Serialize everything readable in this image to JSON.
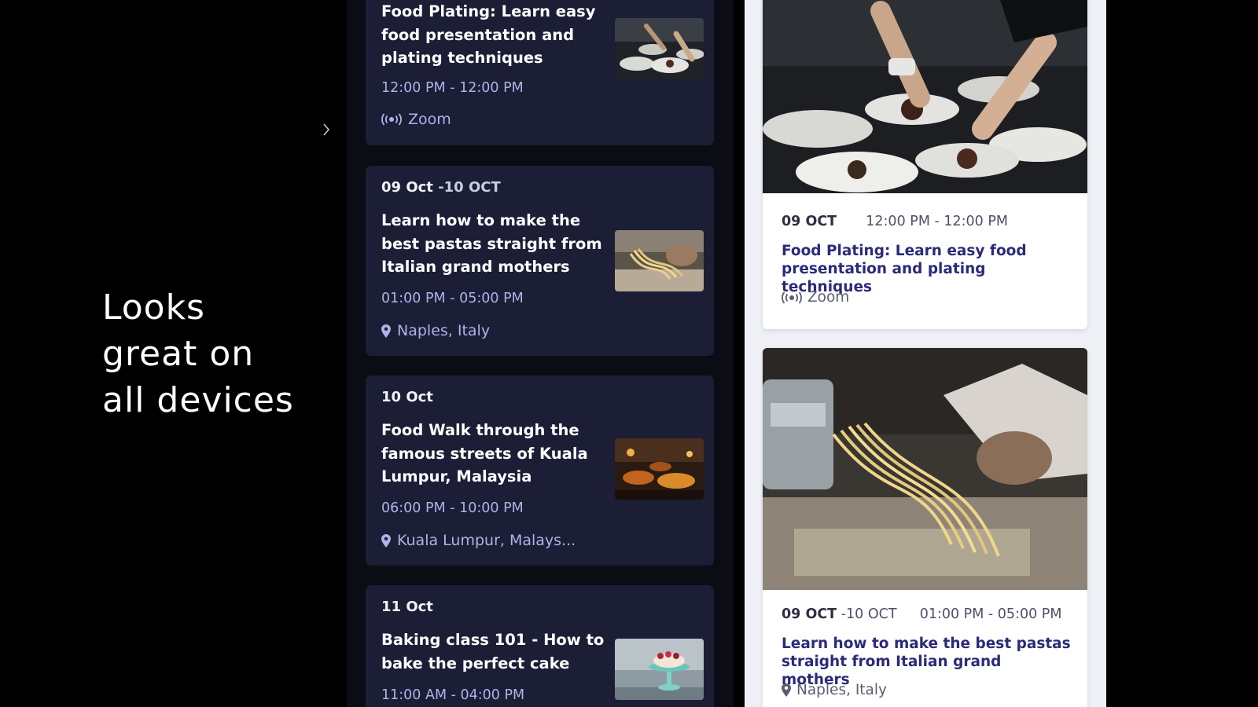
{
  "tagline": [
    "Looks",
    "great on",
    "all devices"
  ],
  "dark_phone": {
    "cards": [
      {
        "title": "Food Plating: Learn easy food presentation and plating techniques",
        "time": "12:00 PM - 12:00 PM",
        "location": "Zoom",
        "location_icon": "broadcast-icon",
        "thumb": "plating"
      },
      {
        "date": "09 Oct",
        "date_end": "-10 OCT",
        "title": "Learn how to make the best pastas straight from Italian grand mothers",
        "time": "01:00 PM - 05:00 PM",
        "location": "Naples, Italy",
        "location_icon": "map-pin-icon",
        "thumb": "pasta"
      },
      {
        "date": "10 Oct",
        "title": "Food Walk through the famous streets of Kuala Lumpur, Malaysia",
        "time": "06:00 PM - 10:00 PM",
        "location": "Kuala Lumpur, Malays...",
        "location_icon": "map-pin-icon",
        "thumb": "street-food"
      },
      {
        "date": "11 Oct",
        "title": "Baking class 101 - How to bake the perfect cake",
        "time": "11:00 AM - 04:00 PM",
        "thumb": "cake"
      }
    ]
  },
  "light_phone": {
    "cards": [
      {
        "date": "09 OCT",
        "time": "12:00 PM - 12:00 PM",
        "title": "Food Plating: Learn easy food presentation and plating techniques",
        "location": "Zoom",
        "location_icon": "broadcast-icon",
        "image": "plating"
      },
      {
        "date": "09 OCT",
        "date_end": "-10 OCT",
        "time": "01:00 PM - 05:00 PM",
        "title": "Learn how to make the best pastas straight from Italian grand mothers",
        "location": "Naples, Italy",
        "location_icon": "map-pin-icon",
        "image": "pasta"
      }
    ]
  },
  "colors": {
    "background": "#000000",
    "dark_card": "#1b1e35",
    "dark_meta": "#aeb3e8",
    "light_title": "#2b2a7a"
  }
}
